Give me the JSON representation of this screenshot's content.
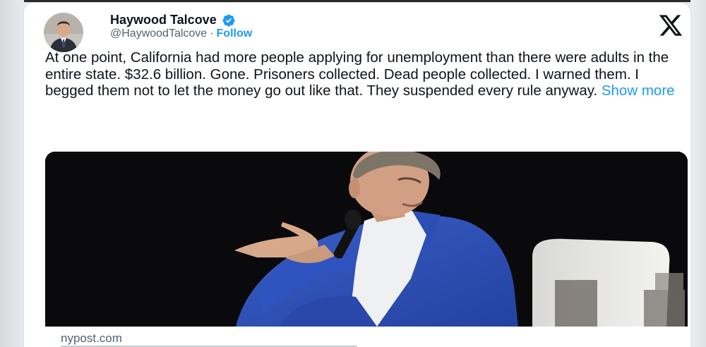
{
  "author": {
    "name": "Haywood Talcove",
    "handle": "@HaywoodTalcove",
    "separator": "·",
    "follow_label": "Follow",
    "verified": true
  },
  "tweet": {
    "text": "At one point, California had more people applying for unemployment than there were adults in the entire state. $32.6 billion. Gone. Prisoners collected. Dead people collected. I warned them. I begged them not to let the money go out like that. They suspended every rule anyway.",
    "show_more_label": "Show more"
  },
  "link_card": {
    "domain": "nypost.com"
  },
  "icons": {
    "close": "x-logo-icon",
    "verified": "verified-badge-icon"
  },
  "colors": {
    "accent": "#1d9bf0",
    "text": "#0f1419",
    "muted": "#536471"
  }
}
